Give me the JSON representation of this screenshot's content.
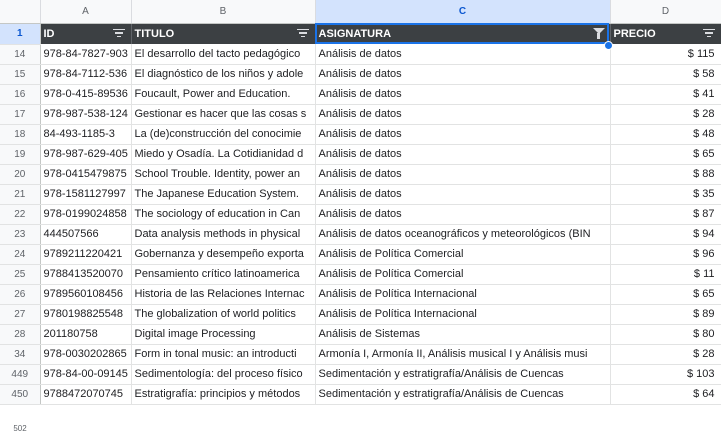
{
  "columns": [
    "A",
    "B",
    "C",
    "D"
  ],
  "header": {
    "row_number": "1",
    "cells": [
      "ID",
      "TITULO",
      "ASIGNATURA",
      "PRECIO"
    ]
  },
  "rows": [
    {
      "n": "14",
      "id": "978-84-7827-903",
      "titulo": "El desarrollo del tacto pedagógico",
      "asignatura": "Análisis de datos",
      "precio": "$ 115"
    },
    {
      "n": "15",
      "id": "978-84-7112-536",
      "titulo": "El diagnóstico de los niños y adole",
      "asignatura": "Análisis de datos",
      "precio": "$ 58"
    },
    {
      "n": "16",
      "id": "978-0-415-89536",
      "titulo": "Foucault, Power and Education.",
      "asignatura": "Análisis de datos",
      "precio": "$ 41"
    },
    {
      "n": "17",
      "id": "978-987-538-124",
      "titulo": "Gestionar es hacer que las cosas s",
      "asignatura": "Análisis de datos",
      "precio": "$ 28"
    },
    {
      "n": "18",
      "id": "84-493-1185-3",
      "titulo": "La (de)construcción del conocimie",
      "asignatura": "Análisis de datos",
      "precio": "$ 48"
    },
    {
      "n": "19",
      "id": "978-987-629-405",
      "titulo": "Miedo y Osadía. La Cotidianidad d",
      "asignatura": "Análisis de datos",
      "precio": "$ 65"
    },
    {
      "n": "20",
      "id": "978-0415479875",
      "titulo": "School Trouble. Identity, power an",
      "asignatura": "Análisis de datos",
      "precio": "$ 88"
    },
    {
      "n": "21",
      "id": "978-1581127997",
      "titulo": "The Japanese Education System.",
      "asignatura": "Análisis de datos",
      "precio": "$ 35"
    },
    {
      "n": "22",
      "id": "978-0199024858",
      "titulo": "The sociology of education in Can",
      "asignatura": "Análisis de datos",
      "precio": "$ 87"
    },
    {
      "n": "23",
      "id": "444507566",
      "titulo": "Data analysis methods in physical",
      "asignatura": "Análisis de datos oceanográficos y meteorológicos (BIN",
      "precio": "$ 94"
    },
    {
      "n": "24",
      "id": "9789211220421",
      "titulo": "Gobernanza y desempeño exporta",
      "asignatura": "Análisis de Política Comercial",
      "precio": "$ 96"
    },
    {
      "n": "25",
      "id": "9788413520070",
      "titulo": "Pensamiento crítico latinoamerica",
      "asignatura": "Análisis de Política Comercial",
      "precio": "$ 11"
    },
    {
      "n": "26",
      "id": "9789560108456",
      "titulo": "Historia de las Relaciones Internac",
      "asignatura": "Análisis de Política Internacional",
      "precio": "$ 65"
    },
    {
      "n": "27",
      "id": "9780198825548",
      "titulo": "The globalization of world politics",
      "asignatura": "Análisis de Política Internacional",
      "precio": "$ 89"
    },
    {
      "n": "28",
      "id": "201180758",
      "titulo": "Digital image Processing",
      "asignatura": "Análisis de Sistemas",
      "precio": "$ 80"
    },
    {
      "n": "34",
      "id": "978-0030202865",
      "titulo": "Form in tonal music: an introducti",
      "asignatura": "Armonía I, Armonía II, Análisis musical I y Análisis musi",
      "precio": "$ 28"
    },
    {
      "n": "449",
      "id": "978-84-00-09145",
      "titulo": "Sedimentología: del proceso físico",
      "asignatura": "Sedimentación y estratigrafía/Análisis de Cuencas",
      "precio": "$ 103"
    },
    {
      "n": "450",
      "id": "9788472070745",
      "titulo": "Estratigrafía: principios y métodos",
      "asignatura": "Sedimentación y estratigrafía/Análisis de Cuencas",
      "precio": "$ 64"
    }
  ],
  "footer_row_number": "502",
  "colors": {
    "header_bg": "#3c4043",
    "selection_blue": "#1a73e8",
    "selected_header_bg": "#d3e3fd"
  },
  "icons": {
    "filter": "filter-lines-icon",
    "active_filter": "funnel-icon"
  }
}
